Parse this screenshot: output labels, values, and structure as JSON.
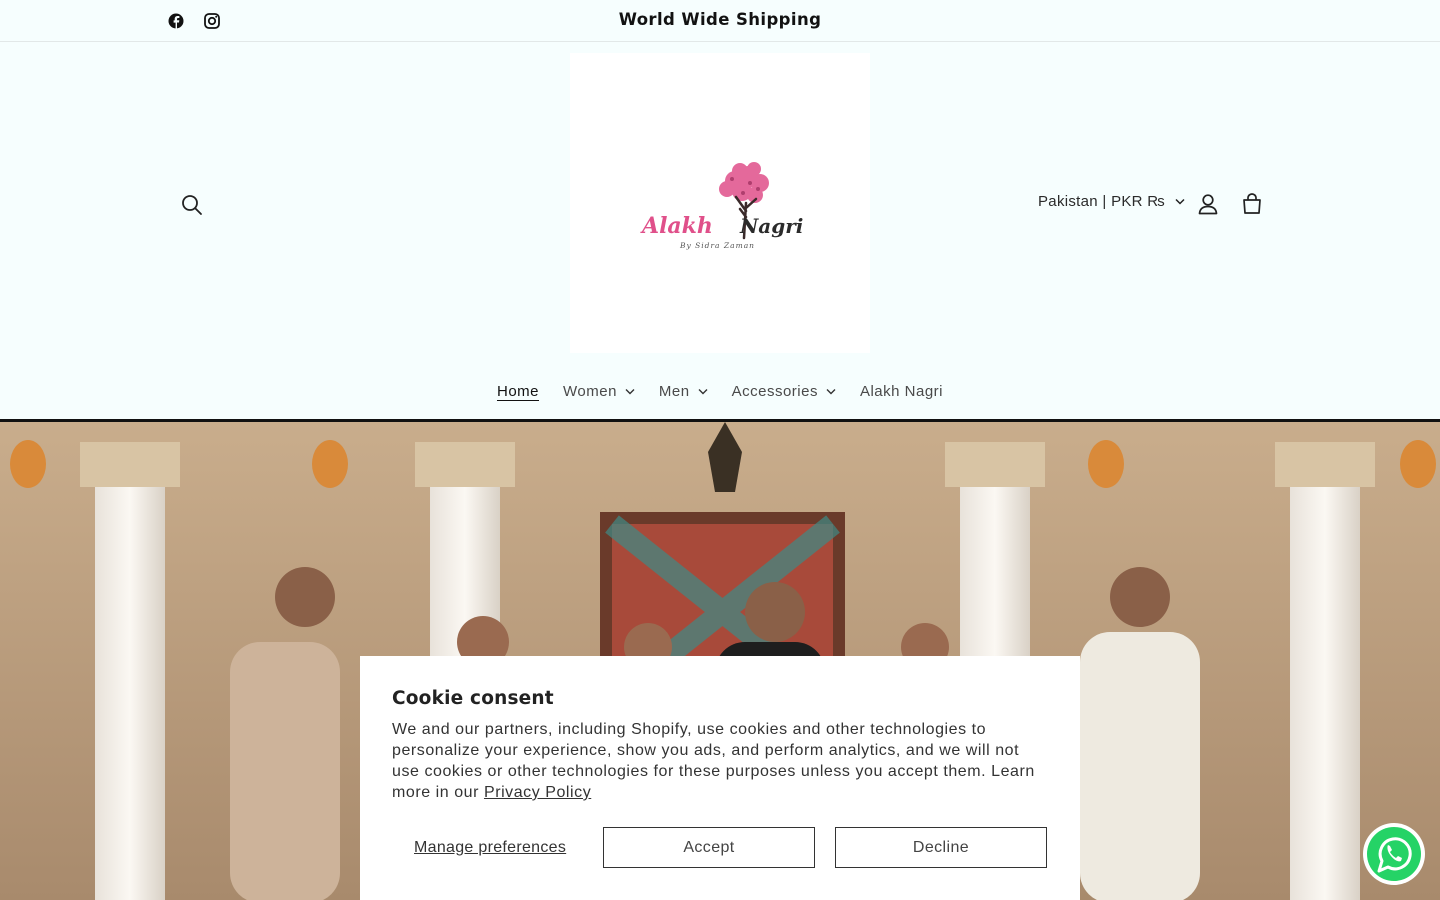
{
  "announcement": {
    "text": "World Wide Shipping"
  },
  "social": [
    {
      "icon": "facebook-icon"
    },
    {
      "icon": "instagram-icon"
    }
  ],
  "logo": {
    "brand": "Alakh Nagri",
    "tagline": "By Sidra Zaman"
  },
  "header": {
    "country_selector": "Pakistan | PKR ₨",
    "icons": [
      "search-icon",
      "account-icon",
      "cart-icon"
    ]
  },
  "nav": [
    {
      "label": "Home",
      "active": true,
      "has_dropdown": false
    },
    {
      "label": "Women",
      "active": false,
      "has_dropdown": true
    },
    {
      "label": "Men",
      "active": false,
      "has_dropdown": true
    },
    {
      "label": "Accessories",
      "active": false,
      "has_dropdown": true
    },
    {
      "label": "Alakh Nagri",
      "active": false,
      "has_dropdown": false
    }
  ],
  "cookie": {
    "title": "Cookie consent",
    "body": "We and our partners, including Shopify, use cookies and other technologies to personalize your experience, show you ads, and perform analytics, and we will not use cookies or other technologies for these purposes unless you accept them. Learn more in our ",
    "privacy_link": "Privacy Policy",
    "manage_label": "Manage preferences",
    "accept_label": "Accept",
    "decline_label": "Decline"
  },
  "colors": {
    "page_bg": "#f6fefe",
    "logo_pink": "#e0508a",
    "whatsapp_green": "#25d366"
  }
}
